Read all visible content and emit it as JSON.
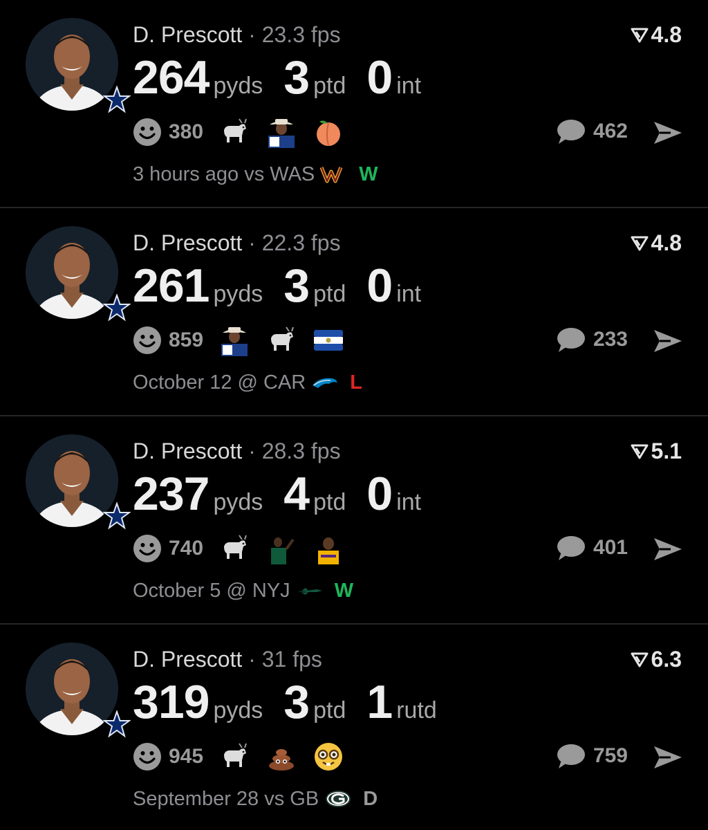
{
  "posts": [
    {
      "player": "D. Prescott",
      "separator": "·",
      "fps": "23.3 fps",
      "rating": "4.8",
      "stats": [
        {
          "value": "264",
          "unit": "pyds"
        },
        {
          "value": "3",
          "unit": "ptd"
        },
        {
          "value": "0",
          "unit": "int"
        }
      ],
      "reactions": "380",
      "emojis": [
        "goat-icon",
        "cowboy-player-icon",
        "peach-icon"
      ],
      "comments": "462",
      "meta": "3 hours ago vs WAS",
      "opponent_logo": "commanders-logo",
      "result": "W"
    },
    {
      "player": "D. Prescott",
      "separator": "·",
      "fps": "22.3 fps",
      "rating": "4.8",
      "stats": [
        {
          "value": "261",
          "unit": "pyds"
        },
        {
          "value": "3",
          "unit": "ptd"
        },
        {
          "value": "0",
          "unit": "int"
        }
      ],
      "reactions": "859",
      "emojis": [
        "cowboy-player-icon",
        "goat-icon",
        "el-salvador-flag-icon"
      ],
      "comments": "233",
      "meta": "October 12 @ CAR",
      "opponent_logo": "panthers-logo",
      "result": "L"
    },
    {
      "player": "D. Prescott",
      "separator": "·",
      "fps": "28.3 fps",
      "rating": "5.1",
      "stats": [
        {
          "value": "237",
          "unit": "pyds"
        },
        {
          "value": "4",
          "unit": "ptd"
        },
        {
          "value": "0",
          "unit": "int"
        }
      ],
      "reactions": "740",
      "emojis": [
        "goat-icon",
        "basketball-player-icon",
        "lakers-player-icon"
      ],
      "comments": "401",
      "meta": "October 5 @ NYJ",
      "opponent_logo": "jets-logo",
      "result": "W"
    },
    {
      "player": "D. Prescott",
      "separator": "·",
      "fps": "31 fps",
      "rating": "6.3",
      "stats": [
        {
          "value": "319",
          "unit": "pyds"
        },
        {
          "value": "3",
          "unit": "ptd"
        },
        {
          "value": "1",
          "unit": "rutd"
        }
      ],
      "reactions": "945",
      "emojis": [
        "goat-icon",
        "poop-icon",
        "nerd-face-icon"
      ],
      "comments": "759",
      "meta": "September 28 vs GB",
      "opponent_logo": "packers-logo",
      "result": "D"
    }
  ],
  "colors": {
    "background": "#000000",
    "win": "#1fb55c",
    "loss": "#e02424",
    "muted": "#8e8e93"
  }
}
